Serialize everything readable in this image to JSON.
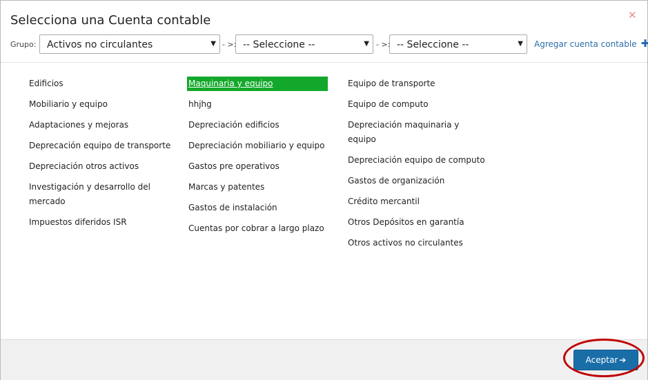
{
  "dialog": {
    "title": "Selecciona una Cuenta contable",
    "close_icon": "close-icon"
  },
  "filters": {
    "group_label": "Grupo:",
    "group_value": "Activos no circulantes",
    "sep1": "- >:",
    "subgroup_value": "-- Seleccione --",
    "sep2": "- >:",
    "subsubgroup_value": "-- Seleccione --",
    "caret_icon": "chevron-down-icon",
    "add_link": "Agregar cuenta contable",
    "add_icon": "plus-icon"
  },
  "accounts": {
    "col1": [
      "Edificios",
      "Mobiliario y equipo",
      "Adaptaciones y mejoras",
      "Deprecación equipo de transporte",
      "Depreciación otros activos",
      "Investigación y desarrollo del mercado",
      "Impuestos diferidos ISR"
    ],
    "col2": [
      "Maquinaria y equipo",
      "hhjhg",
      "Depreciación edificios",
      "Depreciación mobiliario y equipo",
      "Gastos pre operativos",
      "Marcas y patentes",
      "Gastos de instalación",
      "Cuentas por cobrar a largo plazo"
    ],
    "col3": [
      "Equipo de transporte",
      "Equipo de computo",
      "Depreciación maquinaria y equipo",
      "Depreciación equipo de computo",
      "Gastos de organización",
      "Crédito mercantil",
      "Otros Depósitos en garantía",
      "Otros activos no circulantes"
    ],
    "selected": "Maquinaria y equipo"
  },
  "footer": {
    "accept_label": "Aceptar",
    "accept_icon": "arrow-right-icon"
  },
  "colors": {
    "selected_bg": "#13a82b",
    "primary_button": "#1a6ea8",
    "link": "#2a6fa8",
    "annotation_ring": "#c00000"
  }
}
